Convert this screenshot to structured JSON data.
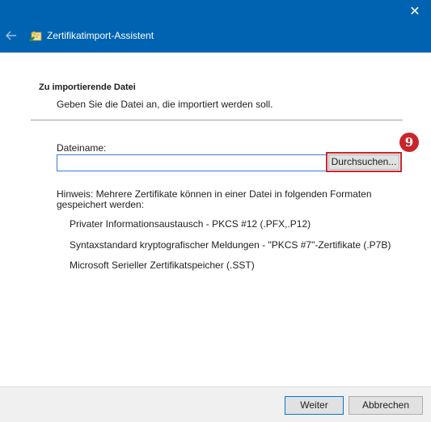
{
  "window": {
    "title": "Zertifikatimport-Assistent",
    "close_glyph": "✕",
    "back_icon": "back-arrow-icon",
    "app_icon": "certificate-wizard-icon"
  },
  "page": {
    "heading": "Zu importierende Datei",
    "subheading": "Geben Sie die Datei an, die importiert werden soll."
  },
  "file": {
    "label": "Dateiname:",
    "value": "",
    "browse_label": "Durchsuchen..."
  },
  "annotation": {
    "badge_number": "9",
    "color": "#c8262c"
  },
  "hint": {
    "text": "Hinweis: Mehrere Zertifikate können in einer Datei in folgenden Formaten gespeichert werden:",
    "formats": [
      "Privater Informationsaustausch - PKCS #12 (.PFX,.P12)",
      "Syntaxstandard kryptografischer Meldungen - \"PKCS #7\"-Zertifikate (.P7B)",
      "Microsoft Serieller Zertifikatspeicher (.SST)"
    ]
  },
  "footer": {
    "next_label": "Weiter",
    "cancel_label": "Abbrechen"
  },
  "colors": {
    "titlebar": "#0063b1",
    "accent": "#0078d7"
  }
}
